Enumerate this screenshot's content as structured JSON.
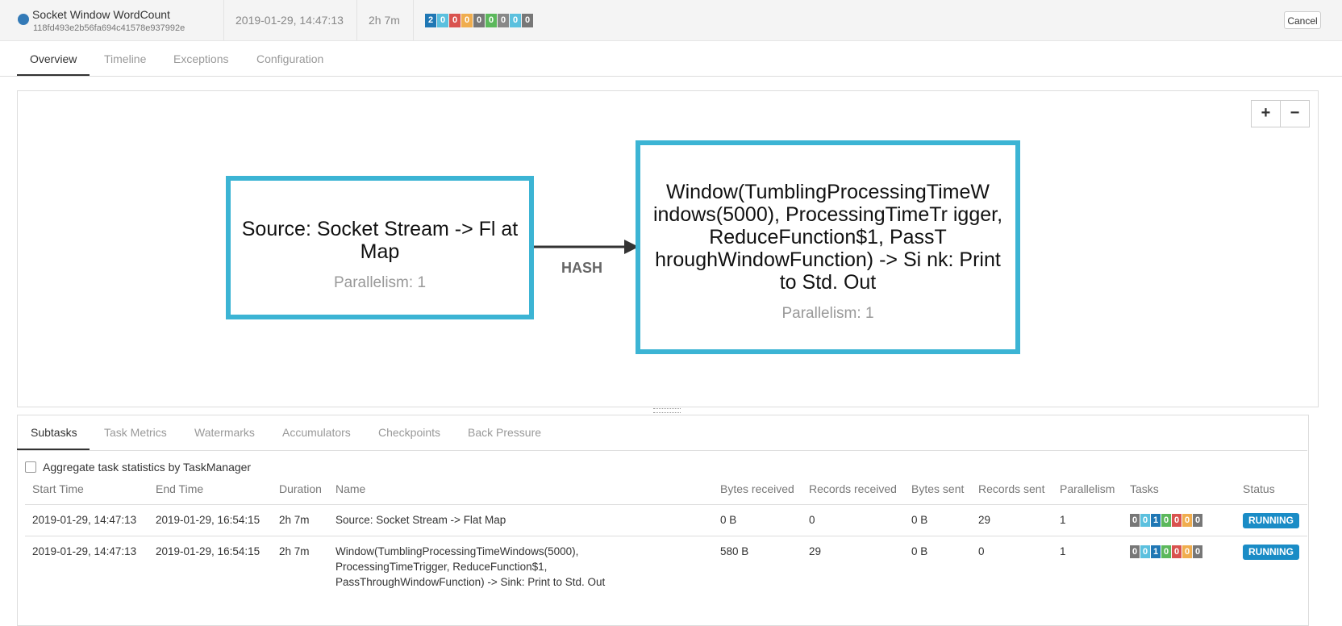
{
  "job": {
    "name": "Socket Window WordCount",
    "id": "118fd493e2b56fa694c41578e937992e",
    "start_time": "2019-01-29, 14:47:13",
    "duration": "2h 7m",
    "task_counts": [
      {
        "value": "2",
        "color": "#1f77b4"
      },
      {
        "value": "0",
        "color": "#5bc0de"
      },
      {
        "value": "0",
        "color": "#d9534f"
      },
      {
        "value": "0",
        "color": "#f0ad4e"
      },
      {
        "value": "0",
        "color": "#777777"
      },
      {
        "value": "0",
        "color": "#5cb85c"
      },
      {
        "value": "0",
        "color": "#888888"
      },
      {
        "value": "0",
        "color": "#5bc0de"
      },
      {
        "value": "0",
        "color": "#777777"
      }
    ],
    "cancel_label": "Cancel"
  },
  "tabs": [
    "Overview",
    "Timeline",
    "Exceptions",
    "Configuration"
  ],
  "graph": {
    "zoom_in": "+",
    "zoom_out": "−",
    "node1": {
      "title": "Source: Socket Stream -> Fl at Map",
      "parallelism": "Parallelism: 1"
    },
    "node2": {
      "title": "Window(TumblingProcessingTimeW indows(5000), ProcessingTimeTr igger, ReduceFunction$1, PassT hroughWindowFunction) -> Si nk: Print to Std. Out",
      "parallelism": "Parallelism: 1"
    },
    "edge_label": "HASH"
  },
  "subtabs": [
    "Subtasks",
    "Task Metrics",
    "Watermarks",
    "Accumulators",
    "Checkpoints",
    "Back Pressure"
  ],
  "aggregate_label": "Aggregate task statistics by TaskManager",
  "columns": [
    "Start Time",
    "End Time",
    "Duration",
    "Name",
    "Bytes received",
    "Records received",
    "Bytes sent",
    "Records sent",
    "Parallelism",
    "Tasks",
    "Status"
  ],
  "rows": [
    {
      "start": "2019-01-29, 14:47:13",
      "end": "2019-01-29, 16:54:15",
      "duration": "2h 7m",
      "name": "Source: Socket Stream -> Flat Map",
      "bytes_received": "0 B",
      "records_received": "0",
      "bytes_sent": "0 B",
      "records_sent": "29",
      "parallelism": "1",
      "tasks": [
        "0",
        "0",
        "1",
        "0",
        "0",
        "0",
        "0"
      ],
      "status": "RUNNING"
    },
    {
      "start": "2019-01-29, 14:47:13",
      "end": "2019-01-29, 16:54:15",
      "duration": "2h 7m",
      "name": "Window(TumblingProcessingTimeWindows(5000), ProcessingTimeTrigger, ReduceFunction$1, PassThroughWindowFunction) -> Sink: Print to Std. Out",
      "bytes_received": "580 B",
      "records_received": "29",
      "bytes_sent": "0 B",
      "records_sent": "0",
      "parallelism": "1",
      "tasks": [
        "0",
        "0",
        "1",
        "0",
        "0",
        "0",
        "0"
      ],
      "status": "RUNNING"
    }
  ],
  "task_colors": [
    "#777777",
    "#5bc0de",
    "#1f77b4",
    "#5cb85c",
    "#d9534f",
    "#f0ad4e",
    "#777777"
  ]
}
